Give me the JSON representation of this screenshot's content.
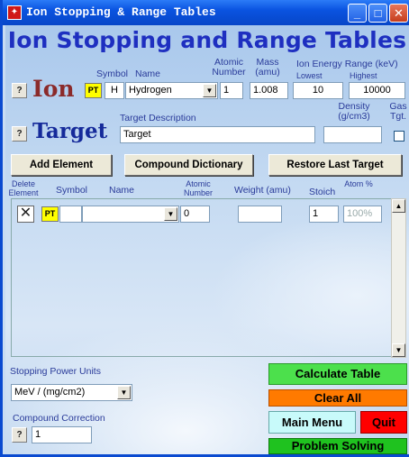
{
  "window": {
    "title": "Ion Stopping & Range Tables",
    "icon_glyph": "✦"
  },
  "title_buttons": {
    "minimize": "_",
    "maximize": "□",
    "close": "✕"
  },
  "main_title": "Ion Stopping and Range Tables",
  "help_label": "?",
  "pt_label": "PT",
  "ion": {
    "label": "Ion",
    "symbol_label": "Symbol",
    "name_label": "Name",
    "atomic_number_label": "Atomic Number",
    "mass_label": "Mass (amu)",
    "energy_label": "Ion Energy Range (keV)",
    "lowest_label": "Lowest",
    "highest_label": "Highest",
    "symbol": "H",
    "name": "Hydrogen",
    "atomic_number": "1",
    "mass": "1.008",
    "energy_lowest": "10",
    "energy_highest": "10000"
  },
  "target": {
    "label": "Target",
    "description_label": "Target Description",
    "density_label": "Density (g/cm3)",
    "gas_label": "Gas Tgt.",
    "description": "Target",
    "density": "",
    "gas_checked": false
  },
  "buttons": {
    "add_element": "Add Element",
    "compound_dictionary": "Compound Dictionary",
    "restore_last_target": "Restore Last Target"
  },
  "element_table": {
    "columns": {
      "delete": "Delete Element",
      "symbol": "Symbol",
      "name": "Name",
      "atomic_number": "Atomic Number",
      "weight": "Weight (amu)",
      "stoich": "Stoich",
      "atom_pct": "Atom %"
    },
    "rows": [
      {
        "delete_glyph": "✕",
        "symbol": "",
        "name": "",
        "atomic_number": "0",
        "weight": "",
        "stoich": "1",
        "atom_pct": "100%"
      }
    ]
  },
  "scroll": {
    "up": "▲",
    "down": "▼"
  },
  "stopping_units": {
    "label": "Stopping Power Units",
    "value": "MeV / (mg/cm2)"
  },
  "compound_correction": {
    "label": "Compound Correction",
    "value": "1"
  },
  "actions": {
    "calculate_table": "Calculate Table",
    "clear_all": "Clear All",
    "main_menu": "Main Menu",
    "quit": "Quit",
    "problem_solving": "Problem Solving"
  },
  "colors": {
    "calculate": "#4ce04c",
    "clear_all": "#ff7a00",
    "main_menu": "#c8fafa",
    "quit": "#ff0000",
    "problem_solving": "#1fc21f"
  },
  "dropdown_arrow": "▼"
}
